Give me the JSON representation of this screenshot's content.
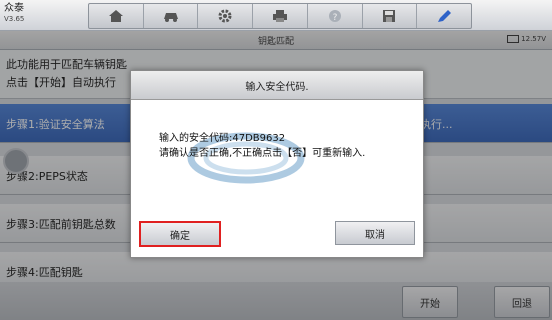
{
  "app": {
    "brand": "众泰",
    "version": "V3.65"
  },
  "header": {
    "title": "钥匙匹配",
    "battery": "12.57V"
  },
  "toolbar": {
    "icons": [
      "home-icon",
      "vehicle-icon",
      "gear-icon",
      "print-icon",
      "help-icon",
      "save-icon",
      "pen-icon"
    ]
  },
  "description": {
    "line1": "此功能用于匹配车辆钥匙",
    "line2": "点击【开始】自动执行"
  },
  "steps": [
    {
      "label": "步骤1:验证安全算法",
      "right": "执行..."
    },
    {
      "label": "步骤2:PEPS状态"
    },
    {
      "label": "步骤3:匹配前钥匙总数"
    },
    {
      "label": "步骤4:匹配钥匙"
    }
  ],
  "footer": {
    "start": "开始",
    "back": "回退"
  },
  "dialog": {
    "title": "输入安全代码.",
    "line1": "输入的安全代码:47DB9632",
    "line2": "请确认是否正确,不正确点击【否】可重新输入.",
    "confirm": "确定",
    "cancel": "取消"
  },
  "colors": {
    "active_step": "#3a6fd0",
    "highlight": "#e02020"
  }
}
